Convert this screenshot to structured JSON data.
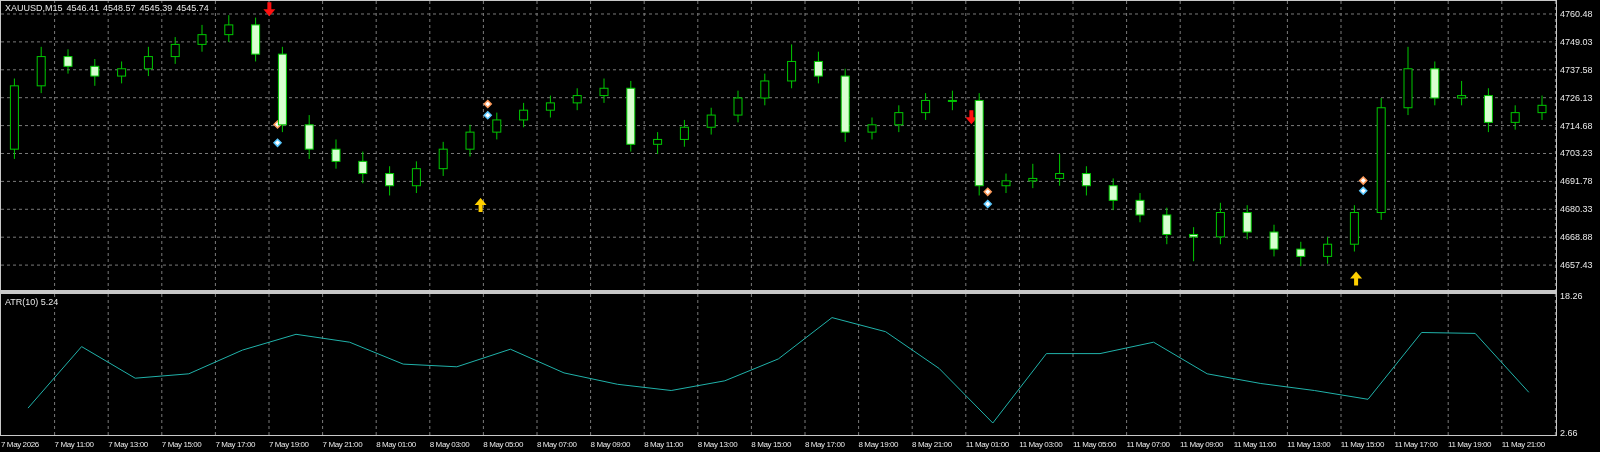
{
  "header": {
    "symbol": "XAUUSD,M15",
    "prices": [
      "4546.41",
      "4548.57",
      "4545.39",
      "4545.74"
    ]
  },
  "price_chart": {
    "chart_data": {
      "type": "candlestick",
      "grid": true,
      "ylim": [
        4647.21,
        4765.81
      ],
      "categories": [
        null,
        null,
        null,
        null,
        null,
        null,
        null,
        null,
        null,
        null,
        null,
        null,
        null,
        null,
        null,
        null,
        null,
        null,
        null,
        null,
        null,
        null,
        null,
        null,
        null,
        null,
        null,
        null,
        null,
        null,
        null,
        null,
        null,
        null,
        null,
        null,
        null,
        null,
        null,
        null,
        null,
        null,
        null,
        null,
        null,
        null,
        null,
        null,
        null,
        null,
        null,
        null,
        null,
        null,
        null,
        null,
        null,
        null
      ],
      "yticks": [
        {
          "value": 4760.48,
          "label": "4760.48"
        },
        {
          "value": 4749.03,
          "label": "4749.03"
        },
        {
          "value": 4737.58,
          "label": "4737.58"
        },
        {
          "value": 4726.13,
          "label": "4726.13"
        },
        {
          "value": 4714.68,
          "label": "4714.68"
        },
        {
          "value": 4703.23,
          "label": "4703.23"
        },
        {
          "value": 4691.78,
          "label": "4691.78"
        },
        {
          "value": 4680.33,
          "label": "4680.33"
        },
        {
          "value": 4668.88,
          "label": "4668.88"
        },
        {
          "value": 4657.43,
          "label": "4657.43"
        }
      ],
      "ohlc": [
        [
          4705,
          4734,
          4701,
          4731
        ],
        [
          4731,
          4747,
          4728,
          4743
        ],
        [
          4743,
          4746,
          4736,
          4739
        ],
        [
          4739,
          4742,
          4731,
          4735
        ],
        [
          4735,
          4741,
          4732,
          4738
        ],
        [
          4738,
          4747,
          4735,
          4743
        ],
        [
          4743,
          4751,
          4740,
          4748
        ],
        [
          4748,
          4756,
          4745,
          4752
        ],
        [
          4752,
          4760,
          4749,
          4756
        ],
        [
          4756,
          4759,
          4741,
          4744
        ],
        [
          4744,
          4747,
          4712,
          4715
        ],
        [
          4715,
          4719,
          4701,
          4705
        ],
        [
          4705,
          4709,
          4697,
          4700
        ],
        [
          4700,
          4704,
          4691,
          4695
        ],
        [
          4695,
          4698,
          4686,
          4690
        ],
        [
          4690,
          4700,
          4687,
          4697
        ],
        [
          4697,
          4708,
          4694,
          4705
        ],
        [
          4705,
          4715,
          4702,
          4712
        ],
        [
          4712,
          4720,
          4709,
          4717
        ],
        [
          4717,
          4724,
          4714,
          4721
        ],
        [
          4721,
          4727,
          4718,
          4724
        ],
        [
          4724,
          4730,
          4721,
          4727
        ],
        [
          4727,
          4734,
          4724,
          4730
        ],
        [
          4730,
          4733,
          4704,
          4707
        ],
        [
          4707,
          4712,
          4703,
          4709
        ],
        [
          4709,
          4717,
          4706,
          4714
        ],
        [
          4714,
          4722,
          4711,
          4719
        ],
        [
          4719,
          4729,
          4716,
          4726
        ],
        [
          4726,
          4736,
          4723,
          4733
        ],
        [
          4733,
          4748,
          4730,
          4741
        ],
        [
          4741,
          4745,
          4732,
          4735
        ],
        [
          4735,
          4738,
          4708,
          4712
        ],
        [
          4712,
          4718,
          4709,
          4715
        ],
        [
          4715,
          4723,
          4712,
          4720
        ],
        [
          4720,
          4728,
          4717,
          4725
        ],
        [
          4725,
          4729,
          4721,
          4725
        ],
        [
          4725,
          4728,
          4686,
          4690
        ],
        [
          4690,
          4695,
          4687,
          4692
        ],
        [
          4692,
          4699,
          4689,
          4693
        ],
        [
          4693,
          4703,
          4690,
          4695
        ],
        [
          4695,
          4698,
          4686,
          4690
        ],
        [
          4690,
          4693,
          4680,
          4684
        ],
        [
          4684,
          4687,
          4675,
          4678
        ],
        [
          4678,
          4681,
          4666,
          4670
        ],
        [
          4670,
          4673,
          4659,
          4669
        ],
        [
          4669,
          4683,
          4666,
          4679
        ],
        [
          4679,
          4682,
          4668,
          4671
        ],
        [
          4671,
          4674,
          4661,
          4664
        ],
        [
          4664,
          4667,
          4657,
          4661
        ],
        [
          4661,
          4669,
          4658,
          4666
        ],
        [
          4666,
          4682,
          4663,
          4679
        ],
        [
          4679,
          4726,
          4676,
          4722
        ],
        [
          4722,
          4747,
          4719,
          4738
        ],
        [
          4738,
          4741,
          4723,
          4726
        ],
        [
          4726,
          4733,
          4723,
          4727
        ],
        [
          4727,
          4730,
          4712,
          4716
        ],
        [
          4716,
          4723,
          4713,
          4720
        ],
        [
          4720,
          4727,
          4717,
          4723
        ]
      ]
    }
  },
  "indicator": {
    "chart_data": {
      "type": "line",
      "title": "ATR(10) 5.24",
      "grid": true,
      "ylim": [
        2.66,
        18.26
      ],
      "yticks": [
        {
          "value": 18.26,
          "label": "18.26"
        },
        {
          "value": 2.66,
          "label": "2.66"
        }
      ],
      "series": [
        {
          "color": "#20b2aa",
          "values": [
            5.5,
            12.5,
            8.9,
            9.4,
            12.1,
            13.9,
            13.0,
            10.5,
            10.2,
            12.2,
            9.5,
            8.2,
            7.5,
            8.6,
            11.1,
            15.8,
            14.2,
            10.0,
            3.8,
            11.7,
            11.7,
            13.0,
            9.4,
            8.3,
            7.5,
            6.5,
            14.1,
            14.0,
            7.3
          ]
        }
      ],
      "categories": [
        "7 May 2026",
        "7 May 11:00",
        "7 May 13:00",
        "7 May 15:00",
        "7 May 17:00",
        "7 May 19:00",
        "7 May 21:00",
        "8 May 01:00",
        "8 May 03:00",
        "8 May 05:00",
        "8 May 07:00",
        "8 May 09:00",
        "8 May 11:00",
        "8 May 13:00",
        "8 May 15:00",
        "8 May 17:00",
        "8 May 19:00",
        "8 May 21:00",
        "11 May 01:00",
        "11 May 03:00",
        "11 May 05:00",
        "11 May 07:00",
        "11 May 09:00",
        "11 May 11:00",
        "11 May 13:00",
        "11 May 15:00",
        "11 May 17:00",
        "11 May 19:00",
        "11 May 21:00"
      ]
    }
  }
}
